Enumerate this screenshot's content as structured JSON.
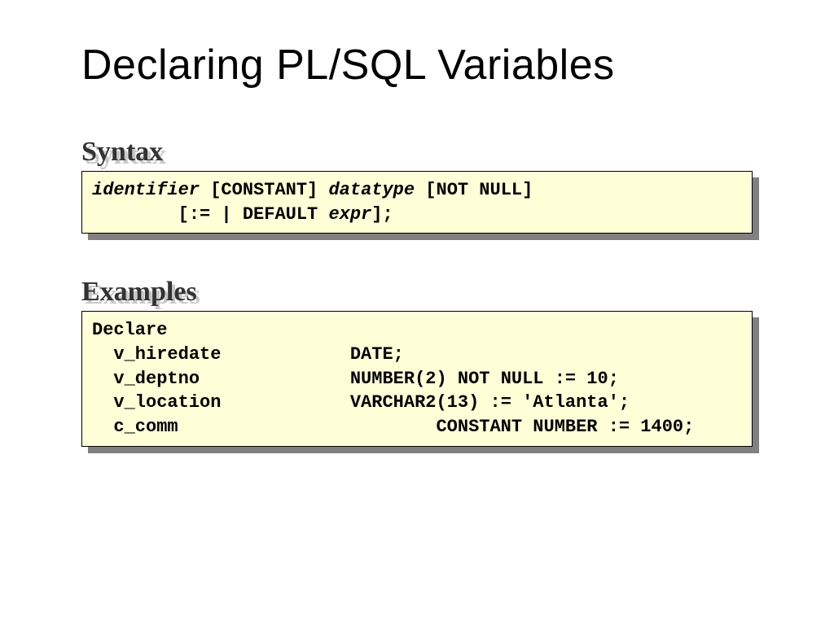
{
  "title": "Declaring PL/SQL Variables",
  "sections": {
    "syntax": {
      "label": "Syntax",
      "code": {
        "l1": {
          "identifier": "identifier",
          "constant": " [CONSTANT] ",
          "datatype": "datatype",
          "notnull": " [NOT NULL]  "
        },
        "l2": {
          "lead": "\t[:= | DEFAULT ",
          "expr": "expr",
          "tail": "];"
        }
      }
    },
    "examples": {
      "label": "Examples",
      "code": {
        "l1": "Declare",
        "l2": "  v_hiredate\t\tDATE;",
        "l3": "  v_deptno\t\tNUMBER(2) NOT NULL := 10;",
        "l4": "  v_location\t\tVARCHAR2(13) := 'Atlanta';",
        "l5": "  c_comm\t\t\tCONSTANT NUMBER := 1400;   "
      }
    }
  }
}
